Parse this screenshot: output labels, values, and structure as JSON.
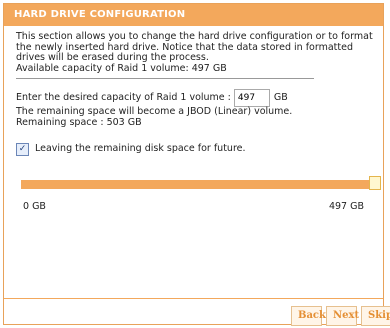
{
  "header": {
    "title": "HARD DRIVE CONFIGURATION"
  },
  "content": {
    "description": "This section allows you to change the hard drive configuration or to format the newly inserted hard drive. Notice that the data stored in formatted drives will be erased during the process.",
    "available": "Available capacity of Raid 1 volume: 497 GB",
    "enter_label": "Enter the desired capacity of Raid 1 volume :",
    "capacity_value": "497",
    "unit": "GB",
    "jbod_note": "The remaining space will become a JBOD (Linear) volume.",
    "remaining": "Remaining space : 503 GB",
    "checkbox_label": "Leaving the remaining disk space for future.",
    "checkbox_checked": true
  },
  "slider": {
    "min_label": "0 GB",
    "max_label": "497 GB",
    "level": 1.0
  },
  "buttons": {
    "back": "Back",
    "next": "Next",
    "skip": "Skip"
  },
  "colors": {
    "accent": "#f3a85c",
    "button_text": "#e48f34",
    "checkbox_border": "#6b86b7"
  },
  "icons": {
    "checkbox": "checkmark-icon"
  }
}
